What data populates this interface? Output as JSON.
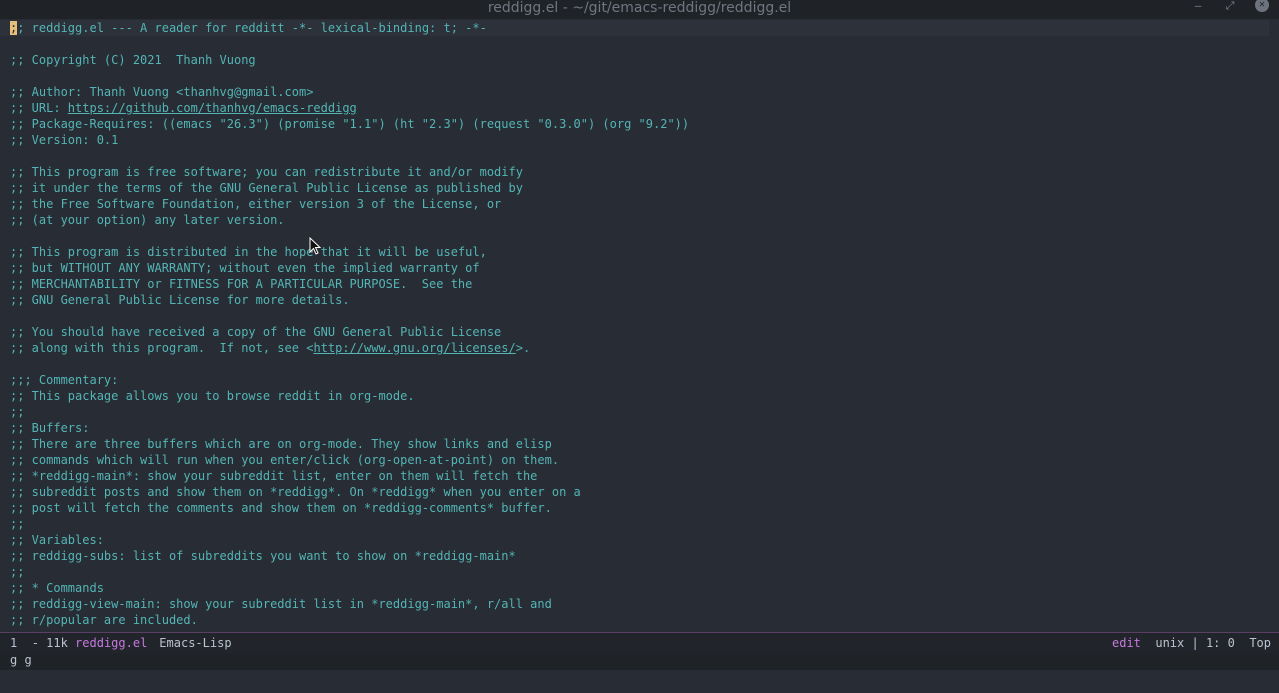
{
  "window": {
    "title": "reddigg.el - ~/git/emacs-reddigg/reddigg.el"
  },
  "buffer": {
    "lines": [
      {
        "text": ";; reddigg.el --- A reader for redditt -*- lexical-binding: t; -*-"
      },
      {
        "text": ""
      },
      {
        "text": ";; Copyright (C) 2021  Thanh Vuong"
      },
      {
        "text": ""
      },
      {
        "text": ";; Author: Thanh Vuong <thanhvg@gmail.com>"
      },
      {
        "text": ";; URL: https://github.com/thanhvg/emacs-reddigg"
      },
      {
        "text": ";; Package-Requires: ((emacs \"26.3\") (promise \"1.1\") (ht \"2.3\") (request \"0.3.0\") (org \"9.2\"))"
      },
      {
        "text": ";; Version: 0.1"
      },
      {
        "text": ""
      },
      {
        "text": ";; This program is free software; you can redistribute it and/or modify"
      },
      {
        "text": ";; it under the terms of the GNU General Public License as published by"
      },
      {
        "text": ";; the Free Software Foundation, either version 3 of the License, or"
      },
      {
        "text": ";; (at your option) any later version."
      },
      {
        "text": ""
      },
      {
        "text": ";; This program is distributed in the hope that it will be useful,"
      },
      {
        "text": ";; but WITHOUT ANY WARRANTY; without even the implied warranty of"
      },
      {
        "text": ";; MERCHANTABILITY or FITNESS FOR A PARTICULAR PURPOSE.  See the"
      },
      {
        "text": ";; GNU General Public License for more details."
      },
      {
        "text": ""
      },
      {
        "text": ";; You should have received a copy of the GNU General Public License"
      },
      {
        "text": ";; along with this program.  If not, see <http://www.gnu.org/licenses/>."
      },
      {
        "text": ""
      },
      {
        "text": ";;; Commentary:"
      },
      {
        "text": ";; This package allows you to browse reddit in org-mode."
      },
      {
        "text": ";;"
      },
      {
        "text": ";; Buffers:"
      },
      {
        "text": ";; There are three buffers which are on org-mode. They show links and elisp"
      },
      {
        "text": ";; commands which will run when you enter/click (org-open-at-point) on them."
      },
      {
        "text": ";; *reddigg-main*: show your subreddit list, enter on them will fetch the"
      },
      {
        "text": ";; subreddit posts and show them on *reddigg*. On *reddigg* when you enter on a"
      },
      {
        "text": ";; post will fetch the comments and show them on *reddigg-comments* buffer."
      },
      {
        "text": ";;"
      },
      {
        "text": ";; Variables:"
      },
      {
        "text": ";; reddigg-subs: list of subreddits you want to show on *reddigg-main*"
      },
      {
        "text": ";;"
      },
      {
        "text": ";; * Commands"
      },
      {
        "text": ";; reddigg-view-main: show your subreddit list in *reddigg-main*, r/all and"
      },
      {
        "text": ";; r/popular are included."
      },
      {
        "text": ";;"
      }
    ]
  },
  "modeline": {
    "line_number": "1",
    "size": "- 11k",
    "buffer_name": "reddigg.el",
    "major_mode": "Emacs-Lisp",
    "state": "edit",
    "encoding": "unix",
    "position": "1: 0",
    "scroll": "Top"
  },
  "minibuffer": {
    "text": "g g"
  },
  "colors": {
    "background": "#282c34",
    "comment": "#53b5b5",
    "accent": "#c678dd",
    "cursor": "#e5c07b"
  }
}
